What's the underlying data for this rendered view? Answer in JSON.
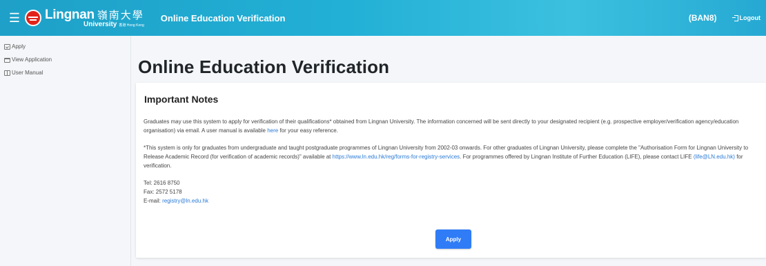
{
  "header": {
    "logo_en": "Lingnan",
    "logo_zh": "嶺南大學",
    "logo_university": "University",
    "logo_hk": "香港 Hong Kong",
    "title": "Online Education Verification",
    "user_code": "(BAN8)",
    "logout_label": "Logout",
    "colors": {
      "bar": "#1ea0c8",
      "logo_red": "#e2231a"
    }
  },
  "sidebar": {
    "items": [
      {
        "label": "Apply",
        "icon": "check-square-icon"
      },
      {
        "label": "View Application",
        "icon": "folder-icon"
      },
      {
        "label": "User Manual",
        "icon": "book-icon"
      }
    ]
  },
  "main": {
    "page_title": "Online Education Verification",
    "notes": {
      "title": "Important Notes",
      "p1_before": "Graduates may use this system to apply for verification of their qualifications* obtained from Lingnan University. The information concerned will be sent directly to your designated recipient (e.g. prospective employer/verification agency/education organisation) via email. A user manual is available ",
      "p1_link": "here",
      "p1_after": " for your easy reference.",
      "p2_before": "*This system is only for graduates from undergraduate and taught postgraduate programmes of Lingnan University from 2002-03 onwards. For other graduates of Lingnan University, please complete the \"Authorisation Form for Lingnan University to Release Academic Record (for verification of academic records)\" available at ",
      "p2_link": "https://www.ln.edu.hk/reg/forms-for-registry-services",
      "p2_middle": ". For programmes offered by Lingnan Institute of Further Education (LIFE), please contact LIFE ",
      "p2_link2": "(life@LN.edu.hk)",
      "p2_after": " for verification.",
      "tel": "Tel: 2616 8750",
      "fax": "Fax: 2572 5178",
      "email_label": "E-mail: ",
      "email": "registry@ln.edu.hk"
    },
    "apply_button": "Apply",
    "colors": {
      "link": "#2a7ad6",
      "button": "#2f7cf6"
    }
  }
}
